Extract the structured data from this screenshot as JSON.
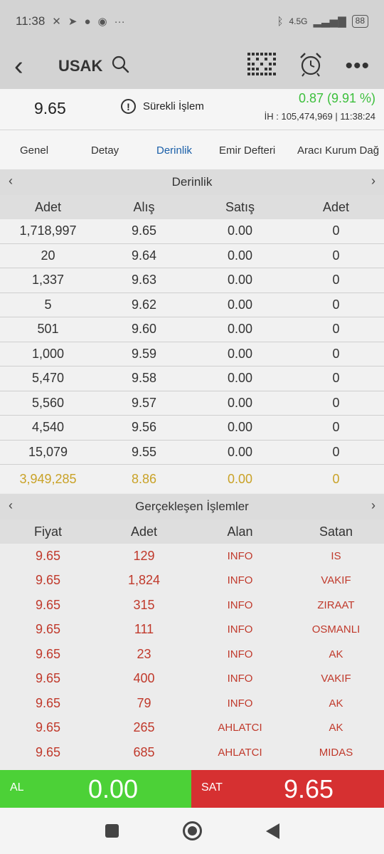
{
  "status_bar": {
    "time": "11:38",
    "battery": "88",
    "network": "4.5G"
  },
  "app_bar": {
    "title": "USAK"
  },
  "price_bar": {
    "last_price": "9.65",
    "status": "Sürekli İşlem",
    "change": "0.87 (9.91 %)",
    "volume_info": "İH : 105,474,969  |  11:38:24"
  },
  "tabs": [
    "Genel",
    "Detay",
    "Derinlik",
    "Emir Defteri",
    "Aracı Kurum Dağ"
  ],
  "depth": {
    "title": "Derinlik",
    "columns": [
      "Adet",
      "Alış",
      "Satış",
      "Adet"
    ],
    "rows": [
      [
        "1,718,997",
        "9.65",
        "0.00",
        "0"
      ],
      [
        "20",
        "9.64",
        "0.00",
        "0"
      ],
      [
        "1,337",
        "9.63",
        "0.00",
        "0"
      ],
      [
        "5",
        "9.62",
        "0.00",
        "0"
      ],
      [
        "501",
        "9.60",
        "0.00",
        "0"
      ],
      [
        "1,000",
        "9.59",
        "0.00",
        "0"
      ],
      [
        "5,470",
        "9.58",
        "0.00",
        "0"
      ],
      [
        "5,560",
        "9.57",
        "0.00",
        "0"
      ],
      [
        "4,540",
        "9.56",
        "0.00",
        "0"
      ],
      [
        "15,079",
        "9.55",
        "0.00",
        "0"
      ]
    ],
    "total": [
      "3,949,285",
      "8.86",
      "0.00",
      "0"
    ]
  },
  "trades": {
    "title": "Gerçekleşen İşlemler",
    "columns": [
      "Fiyat",
      "Adet",
      "Alan",
      "Satan"
    ],
    "rows": [
      [
        "9.65",
        "129",
        "INFO",
        "IS"
      ],
      [
        "9.65",
        "1,824",
        "INFO",
        "VAKIF"
      ],
      [
        "9.65",
        "315",
        "INFO",
        "ZIRAAT"
      ],
      [
        "9.65",
        "111",
        "INFO",
        "OSMANLI"
      ],
      [
        "9.65",
        "23",
        "INFO",
        "AK"
      ],
      [
        "9.65",
        "400",
        "INFO",
        "VAKIF"
      ],
      [
        "9.65",
        "79",
        "INFO",
        "AK"
      ],
      [
        "9.65",
        "265",
        "AHLATCI",
        "AK"
      ],
      [
        "9.65",
        "685",
        "AHLATCI",
        "MIDAS"
      ]
    ]
  },
  "buy": {
    "label": "AL",
    "value": "0.00"
  },
  "sell": {
    "label": "SAT",
    "value": "9.65"
  },
  "colors": {
    "buy": "#4cd137",
    "sell": "#d63031",
    "positive": "#3cbf3c",
    "active_tab": "#1a5fa8",
    "total_row": "#c9a227",
    "trade_text": "#c0392b"
  }
}
